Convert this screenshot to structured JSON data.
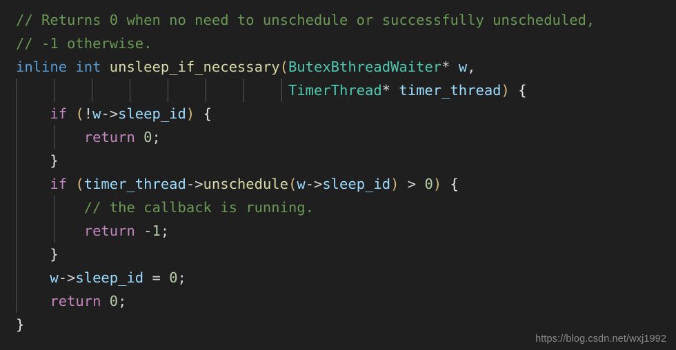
{
  "editor": {
    "background": "#1f1f1f",
    "language": "cpp",
    "font_size_px": 20.5,
    "line_height_px": 34,
    "indent_guide_color": "#5a5a5a",
    "colors": {
      "comment": "#6a9955",
      "keyword_control": "#c586c0",
      "keyword_type": "#569cd6",
      "class_type": "#4ec9b0",
      "function": "#dcdcaa",
      "variable": "#9cdcfe",
      "number": "#b5cea8",
      "punctuation": "#d4d4d4",
      "bracket_paren": "#d7ba7d",
      "bracket_brace": "#e8e8e8"
    }
  },
  "code": {
    "lines": [
      {
        "id": "line-1",
        "text": "// Returns 0 when no need to unschedule or successfully unscheduled,",
        "tokens": [
          {
            "t": "// Returns 0 when no need to unschedule or successfully unscheduled,",
            "c": "cmt"
          }
        ],
        "guides": []
      },
      {
        "id": "line-2",
        "text": "// -1 otherwise.",
        "tokens": [
          {
            "t": "// -1 otherwise.",
            "c": "cmt"
          }
        ],
        "guides": []
      },
      {
        "id": "line-3",
        "text": "inline int unsleep_if_necessary(ButexBthreadWaiter* w,",
        "tokens": [
          {
            "t": "inline",
            "c": "kw2"
          },
          {
            "t": " ",
            "c": "punct"
          },
          {
            "t": "int",
            "c": "kw2"
          },
          {
            "t": " ",
            "c": "punct"
          },
          {
            "t": "unsleep_if_necessary",
            "c": "fn"
          },
          {
            "t": "(",
            "c": "par"
          },
          {
            "t": "ButexBthreadWaiter",
            "c": "type"
          },
          {
            "t": "*",
            "c": "op"
          },
          {
            "t": " ",
            "c": "punct"
          },
          {
            "t": "w",
            "c": "var"
          },
          {
            "t": ",",
            "c": "punct"
          }
        ],
        "guides": []
      },
      {
        "id": "line-4",
        "text": "                                TimerThread* timer_thread) {",
        "tokens": [
          {
            "t": "                                ",
            "c": "punct"
          },
          {
            "t": "TimerThread",
            "c": "type"
          },
          {
            "t": "*",
            "c": "op"
          },
          {
            "t": " ",
            "c": "punct"
          },
          {
            "t": "timer_thread",
            "c": "var"
          },
          {
            "t": ")",
            "c": "par"
          },
          {
            "t": " ",
            "c": "punct"
          },
          {
            "t": "{",
            "c": "brc"
          }
        ],
        "guides": [
          23,
          78,
          133,
          188,
          243,
          298,
          353,
          408
        ]
      },
      {
        "id": "line-5",
        "text": "    if (!w->sleep_id) {",
        "tokens": [
          {
            "t": "    ",
            "c": "punct"
          },
          {
            "t": "if",
            "c": "kw"
          },
          {
            "t": " ",
            "c": "punct"
          },
          {
            "t": "(",
            "c": "par"
          },
          {
            "t": "!",
            "c": "op"
          },
          {
            "t": "w",
            "c": "var"
          },
          {
            "t": "->",
            "c": "op"
          },
          {
            "t": "sleep_id",
            "c": "var"
          },
          {
            "t": ")",
            "c": "par"
          },
          {
            "t": " ",
            "c": "punct"
          },
          {
            "t": "{",
            "c": "brc"
          }
        ],
        "guides": [
          23
        ]
      },
      {
        "id": "line-6",
        "text": "        return 0;",
        "tokens": [
          {
            "t": "        ",
            "c": "punct"
          },
          {
            "t": "return",
            "c": "kw"
          },
          {
            "t": " ",
            "c": "punct"
          },
          {
            "t": "0",
            "c": "num"
          },
          {
            "t": ";",
            "c": "punct"
          }
        ],
        "guides": [
          23,
          78
        ]
      },
      {
        "id": "line-7",
        "text": "    }",
        "tokens": [
          {
            "t": "    ",
            "c": "punct"
          },
          {
            "t": "}",
            "c": "brc"
          }
        ],
        "guides": [
          23
        ]
      },
      {
        "id": "line-8",
        "text": "    if (timer_thread->unschedule(w->sleep_id) > 0) {",
        "tokens": [
          {
            "t": "    ",
            "c": "punct"
          },
          {
            "t": "if",
            "c": "kw"
          },
          {
            "t": " ",
            "c": "punct"
          },
          {
            "t": "(",
            "c": "par"
          },
          {
            "t": "timer_thread",
            "c": "var"
          },
          {
            "t": "->",
            "c": "op"
          },
          {
            "t": "unschedule",
            "c": "fn"
          },
          {
            "t": "(",
            "c": "par"
          },
          {
            "t": "w",
            "c": "var"
          },
          {
            "t": "->",
            "c": "op"
          },
          {
            "t": "sleep_id",
            "c": "var"
          },
          {
            "t": ")",
            "c": "par"
          },
          {
            "t": " ",
            "c": "punct"
          },
          {
            "t": ">",
            "c": "op"
          },
          {
            "t": " ",
            "c": "punct"
          },
          {
            "t": "0",
            "c": "num"
          },
          {
            "t": ")",
            "c": "par"
          },
          {
            "t": " ",
            "c": "punct"
          },
          {
            "t": "{",
            "c": "brc"
          }
        ],
        "guides": [
          23
        ]
      },
      {
        "id": "line-9",
        "text": "        // the callback is running.",
        "tokens": [
          {
            "t": "        ",
            "c": "punct"
          },
          {
            "t": "// the callback is running.",
            "c": "cmt"
          }
        ],
        "guides": [
          23,
          78
        ]
      },
      {
        "id": "line-10",
        "text": "        return -1;",
        "tokens": [
          {
            "t": "        ",
            "c": "punct"
          },
          {
            "t": "return",
            "c": "kw"
          },
          {
            "t": " ",
            "c": "punct"
          },
          {
            "t": "-",
            "c": "op"
          },
          {
            "t": "1",
            "c": "num"
          },
          {
            "t": ";",
            "c": "punct"
          }
        ],
        "guides": [
          23,
          78
        ]
      },
      {
        "id": "line-11",
        "text": "    }",
        "tokens": [
          {
            "t": "    ",
            "c": "punct"
          },
          {
            "t": "}",
            "c": "brc"
          }
        ],
        "guides": [
          23
        ]
      },
      {
        "id": "line-12",
        "text": "    w->sleep_id = 0;",
        "tokens": [
          {
            "t": "    ",
            "c": "punct"
          },
          {
            "t": "w",
            "c": "var"
          },
          {
            "t": "->",
            "c": "op"
          },
          {
            "t": "sleep_id",
            "c": "var"
          },
          {
            "t": " ",
            "c": "punct"
          },
          {
            "t": "=",
            "c": "op"
          },
          {
            "t": " ",
            "c": "punct"
          },
          {
            "t": "0",
            "c": "num"
          },
          {
            "t": ";",
            "c": "punct"
          }
        ],
        "guides": [
          23
        ]
      },
      {
        "id": "line-13",
        "text": "    return 0;",
        "tokens": [
          {
            "t": "    ",
            "c": "punct"
          },
          {
            "t": "return",
            "c": "kw"
          },
          {
            "t": " ",
            "c": "punct"
          },
          {
            "t": "0",
            "c": "num"
          },
          {
            "t": ";",
            "c": "punct"
          }
        ],
        "guides": [
          23
        ]
      },
      {
        "id": "line-14",
        "text": "}",
        "tokens": [
          {
            "t": "}",
            "c": "brc"
          }
        ],
        "guides": []
      }
    ]
  },
  "watermark": {
    "text": "https://blog.csdn.net/wxj1992"
  }
}
